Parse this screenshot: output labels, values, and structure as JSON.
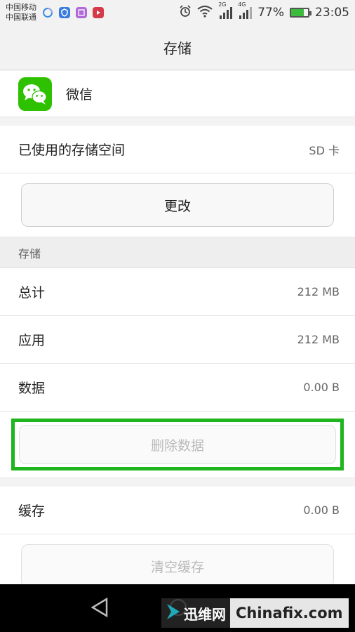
{
  "status_bar": {
    "carrier_1": "中国移动",
    "carrier_2": "中国联通",
    "sig1_tag": "2G",
    "sig2_tag": "4G",
    "battery": "77%",
    "battery_level": 0.77,
    "time": "23:05",
    "icons": [
      "qq-icon",
      "shield-icon",
      "photo-app-icon",
      "video-app-icon",
      "alarm-icon",
      "wifi-icon",
      "signal-icon",
      "battery-icon"
    ]
  },
  "title_bar": {
    "title": "存储"
  },
  "app": {
    "name": "微信",
    "icon": "wechat-icon",
    "brand_color": "#2dc100"
  },
  "storage_location": {
    "label": "已使用的存储空间",
    "value": "SD 卡"
  },
  "change_button": {
    "label": "更改"
  },
  "storage_section": {
    "header": "存储"
  },
  "storage_rows": [
    {
      "label": "总计",
      "value": "212 MB"
    },
    {
      "label": "应用",
      "value": "212 MB"
    },
    {
      "label": "数据",
      "value": "0.00 B"
    }
  ],
  "delete_data_button": {
    "label": "删除数据",
    "highlight_color": "#1fb51f"
  },
  "cache_row": {
    "label": "缓存",
    "value": "0.00 B"
  },
  "clear_cache_button": {
    "label": "清空缓存"
  },
  "watermark": {
    "cn": "迅维网",
    "en": "Chinafix.com"
  }
}
